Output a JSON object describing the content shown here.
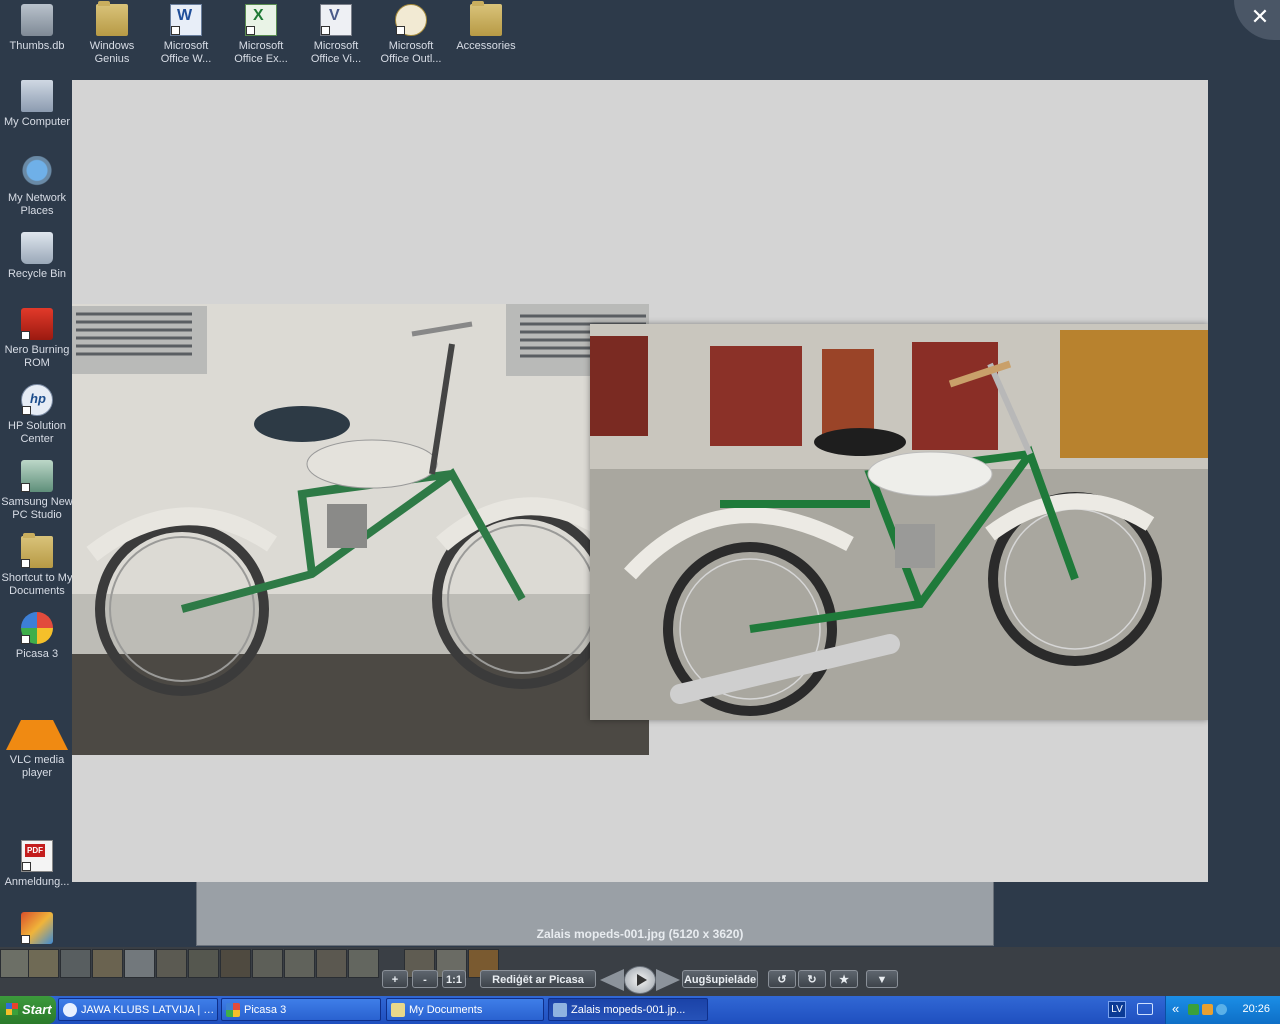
{
  "desktop": {
    "icons": [
      {
        "label": "Thumbs.db"
      },
      {
        "label": "Windows Genius"
      },
      {
        "label": "Microsoft Office W..."
      },
      {
        "label": "Microsoft Office Ex..."
      },
      {
        "label": "Microsoft Office Vi..."
      },
      {
        "label": "Microsoft Office Outl..."
      },
      {
        "label": "Accessories"
      },
      {
        "label": "My Computer"
      },
      {
        "label": "My Network Places"
      },
      {
        "label": "Recycle Bin"
      },
      {
        "label": "Nero Burning ROM"
      },
      {
        "label": "HP Solution Center"
      },
      {
        "label": "Samsung New PC Studio"
      },
      {
        "label": "Shortcut to My Documents"
      },
      {
        "label": "Picasa 3"
      },
      {
        "label": "VLC media player"
      },
      {
        "label": "Anmeldung..."
      },
      {
        "label": ""
      }
    ]
  },
  "viewer": {
    "close_label": "✕",
    "caption": "Zalais mopeds-001.jpg (5120 x 3620)",
    "controls": {
      "zoom_in": "+",
      "zoom_out": "-",
      "actual_size": "1:1",
      "edit": "Rediģēt ar Picasa",
      "upload": "Augšupielāde",
      "rotate_left": "↺",
      "rotate_right": "↻",
      "star": "★",
      "more": "▼"
    }
  },
  "taskbar": {
    "start_label": "Start",
    "tasks": [
      {
        "label": "JAWA KLUBS LATVIJA | J..."
      },
      {
        "label": "Picasa 3"
      },
      {
        "label": "My Documents"
      },
      {
        "label": "Zalais mopeds-001.jp..."
      }
    ],
    "tray": {
      "lang": "LV",
      "collapse": "«",
      "clock": "20:26"
    }
  }
}
